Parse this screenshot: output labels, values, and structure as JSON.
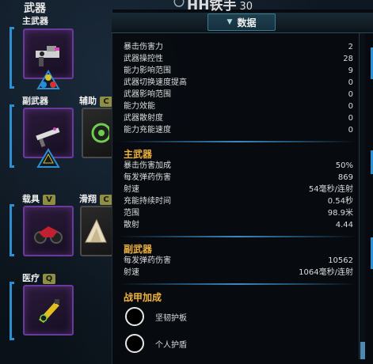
{
  "loadout": {
    "title": "武器",
    "slots": [
      {
        "label": "主武器"
      },
      {
        "label": "副武器"
      },
      {
        "label": "辅助",
        "key": "C"
      },
      {
        "label": "载具",
        "key": "V"
      },
      {
        "label": "滑翔",
        "key": "C"
      },
      {
        "label": "医疗",
        "key": "Q"
      }
    ]
  },
  "character": {
    "name": "HH铁手",
    "level": "30"
  },
  "panel": {
    "tab_label": "数据",
    "general_stats": [
      {
        "label": "暴击伤害力",
        "value": "2"
      },
      {
        "label": "武器操控性",
        "value": "28"
      },
      {
        "label": "能力影响范围",
        "value": "9"
      },
      {
        "label": "武器切换速度提高",
        "value": "0"
      },
      {
        "label": "武器影响范围",
        "value": "0"
      },
      {
        "label": "能力效能",
        "value": "0"
      },
      {
        "label": "武器散射度",
        "value": "0"
      },
      {
        "label": "能力充能速度",
        "value": "0"
      }
    ],
    "primary": {
      "title": "主武器",
      "stats": [
        {
          "label": "暴击伤害加成",
          "value": "50%"
        },
        {
          "label": "每发弹药伤害",
          "value": "869"
        },
        {
          "label": "射速",
          "value": "54毫秒/连射"
        },
        {
          "label": "充能持续时间",
          "value": "0.54秒"
        },
        {
          "label": "范围",
          "value": "98.9米"
        },
        {
          "label": "散射",
          "value": "4.44"
        }
      ]
    },
    "secondary": {
      "title": "副武器",
      "stats": [
        {
          "label": "每发弹药伤害",
          "value": "10562"
        },
        {
          "label": "射速",
          "value": "1064毫秒/连射"
        }
      ]
    },
    "armor": {
      "title": "战甲加成",
      "items": [
        {
          "label": "坚韧护板"
        },
        {
          "label": "个人护盾"
        }
      ]
    }
  },
  "colors": {
    "accent": "#f0b23a",
    "frame": "#6a3a9a",
    "bracket": "#2e8fd0"
  }
}
